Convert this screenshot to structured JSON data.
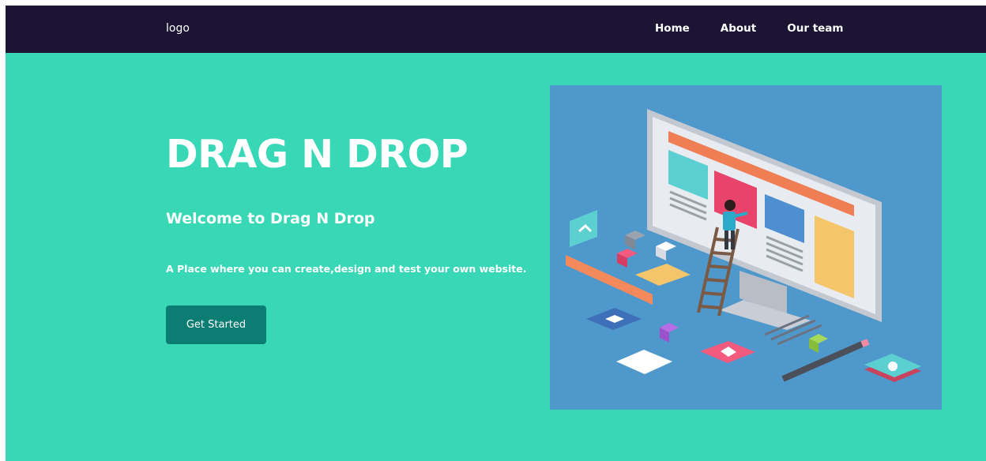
{
  "navbar": {
    "logo": "logo",
    "links": [
      {
        "label": "Home"
      },
      {
        "label": "About"
      },
      {
        "label": "Our team"
      }
    ]
  },
  "hero": {
    "title": "DRAG N DROP",
    "subtitle": "Welcome to Drag N Drop",
    "description": "A Place where you can create,design and test your own website.",
    "cta_label": "Get Started"
  },
  "colors": {
    "navbar_bg": "#1b1433",
    "hero_bg": "#38d8b6",
    "button_bg": "#0b7d73",
    "illustration_bg": "#4f98cc"
  }
}
